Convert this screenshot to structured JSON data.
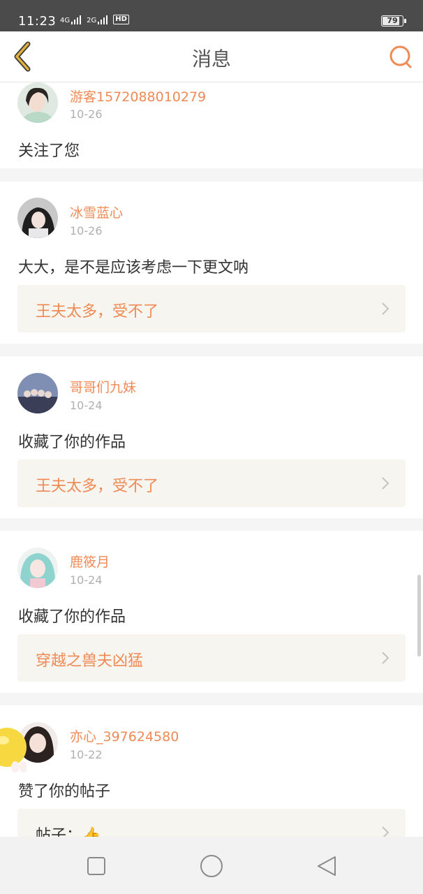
{
  "status_bar": {
    "time": "11:23",
    "network_1": "4G",
    "network_2": "2G",
    "hd_badge": "HD",
    "battery": "79"
  },
  "header": {
    "title": "消息",
    "back_icon": "chevron-left-icon",
    "search_icon": "search-icon"
  },
  "notifications": [
    {
      "username": "游客1572088010279",
      "date": "10-26",
      "message": "关注了您",
      "work_title": null
    },
    {
      "username": "冰雪蓝心",
      "date": "10-26",
      "message": "大大，是不是应该考虑一下更文呐",
      "work_title": "王夫太多，受不了"
    },
    {
      "username": "哥哥们九妹",
      "date": "10-24",
      "message": "收藏了你的作品",
      "work_title": "王夫太多，受不了"
    },
    {
      "username": "鹿筱月",
      "date": "10-24",
      "message": "收藏了你的作品",
      "work_title": "穿越之兽夫凶猛"
    },
    {
      "username": "亦心_397624580",
      "date": "10-22",
      "message": "赞了你的帖子",
      "work_title": "帖子：👍"
    }
  ],
  "nav_bar": {
    "recents_icon": "square-icon",
    "home_icon": "circle-icon",
    "back_icon": "triangle-back-icon"
  },
  "colors": {
    "accent": "#f08a55",
    "back_arrow": "#e2b13a",
    "username": "#f08a55",
    "date": "#b0b0b0",
    "work_bg": "#f6f5ef"
  }
}
